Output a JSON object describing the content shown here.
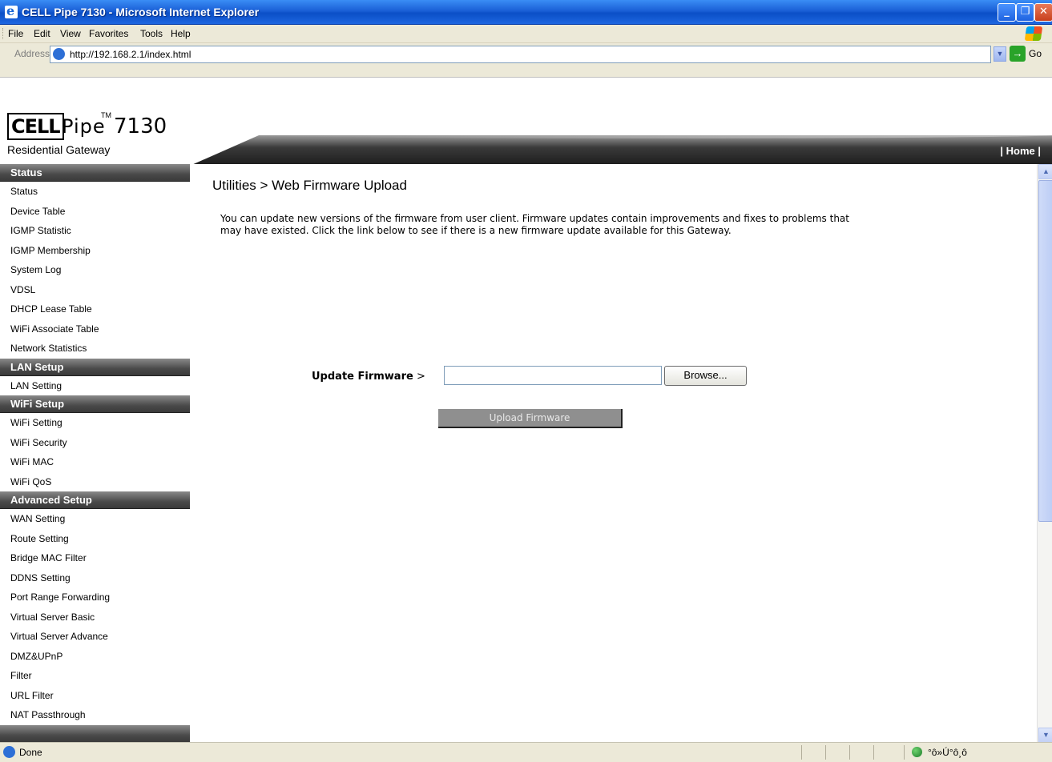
{
  "window": {
    "title": "CELL Pipe 7130 - Microsoft Internet Explorer"
  },
  "menubar": {
    "items": [
      "File",
      "Edit",
      "View",
      "Favorites",
      "Tools",
      "Help"
    ]
  },
  "address": {
    "label": "Address",
    "url": "http://192.168.2.1/index.html",
    "go": "Go"
  },
  "header": {
    "logo_cell": "CELL",
    "logo_pipe": "Pipe",
    "logo_tm": "TM",
    "logo_model": "7130",
    "logo_sub": "Residential Gateway",
    "home": "| Home |"
  },
  "sidebar": {
    "sections": [
      {
        "title": "Status",
        "items": [
          "Status",
          "Device Table",
          "IGMP Statistic",
          "IGMP Membership",
          "System Log",
          "VDSL",
          "DHCP Lease Table",
          "WiFi Associate Table",
          "Network Statistics"
        ]
      },
      {
        "title": "LAN Setup",
        "items": [
          "LAN Setting"
        ]
      },
      {
        "title": "WiFi Setup",
        "items": [
          "WiFi Setting",
          "WiFi Security",
          "WiFi MAC",
          "WiFi QoS"
        ]
      },
      {
        "title": "Advanced Setup",
        "items": [
          "WAN Setting",
          "Route Setting",
          "Bridge MAC Filter",
          "DDNS Setting",
          "Port Range Forwarding",
          "Virtual Server Basic",
          "Virtual Server Advance",
          "DMZ&UPnP",
          "Filter",
          "URL Filter",
          "NAT Passthrough"
        ]
      }
    ]
  },
  "main": {
    "breadcrumb": "Utilities > Web Firmware Upload",
    "intro": "You can update new versions of the firmware from user client. Firmware updates contain improvements and fixes to problems that may have existed. Click the link below to see if there is a new firmware update available for this Gateway.",
    "fw_label": "Update Firmware",
    "fw_arrow": " >",
    "fw_value": "",
    "browse": "Browse...",
    "upload": "Upload Firmware"
  },
  "status": {
    "text": "Done",
    "zone": "°ô»Ú°ô¸ô"
  }
}
